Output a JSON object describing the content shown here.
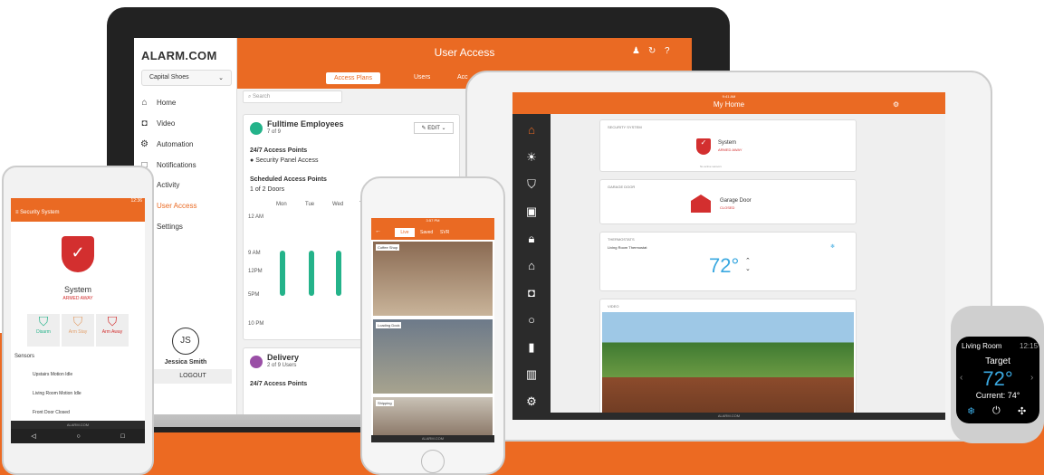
{
  "laptop": {
    "logo": "ALARM.COM",
    "account": "Capital Shoes",
    "title": "User Access",
    "tabs": [
      "Access Plans",
      "Users",
      "Acc"
    ],
    "sidebar": [
      "Home",
      "Video",
      "Automation",
      "Notifications",
      "Activity",
      "User Access",
      "Settings"
    ],
    "search_placeholder": "Search",
    "plan1": {
      "name": "Fulltime Employees",
      "count": "7 of 9",
      "edit": "EDIT",
      "access": "24/7 Access Points",
      "panel": "Security Panel Access",
      "scheduled": "Scheduled Access Points",
      "doors": "1 of 2 Doors",
      "days": [
        "Mon",
        "Tue",
        "Wed",
        "Th"
      ],
      "times": [
        "12 AM",
        "9 AM",
        "12PM",
        "5PM",
        "10 PM"
      ]
    },
    "plan2": {
      "name": "Delivery",
      "count": "2 of 9 Users",
      "access": "24/7 Access Points"
    },
    "user": {
      "initials": "JS",
      "name": "Jessica Smith",
      "logout": "LOGOUT"
    }
  },
  "android": {
    "time": "12:36",
    "title": "Security System",
    "status_label": "System",
    "status": "ARMED AWAY",
    "modes": [
      "Disarm",
      "Arm Stay",
      "Arm Away"
    ],
    "sensors_title": "Sensors",
    "sensors": [
      "Upstairs Motion Idle",
      "Living Room Motion Idle",
      "Front Door Closed"
    ],
    "footer": "ALARM.COM"
  },
  "iphone": {
    "time": "3:57 PM",
    "battery": "100%",
    "tabs": [
      "Live",
      "Saved",
      "SVR"
    ],
    "cams": [
      "Coffee Shop",
      "Loading Dock",
      "Shipping"
    ],
    "footer": "ALARM.COM"
  },
  "ipad": {
    "time": "9:41 AM",
    "battery": "100%",
    "title": "My Home",
    "security_title": "SECURITY SYSTEM",
    "security_label": "System",
    "security_status": "ARMED AWAY",
    "sensors": "No active sensors",
    "garage_title": "GARAGE DOOR",
    "garage_label": "Garage Door",
    "garage_status": "CLOSED",
    "thermo_title": "THERMOSTATS",
    "thermo_name": "Living Room Thermostat",
    "temp": "72°",
    "video_title": "VIDEO",
    "footer": "ALARM.COM"
  },
  "watch": {
    "room": "Living Room",
    "time": "12:15",
    "target_label": "Target",
    "temp": "72°",
    "current": "Current: 74°"
  },
  "colors": {
    "orange": "#ec6a22",
    "red": "#d32f2f",
    "green": "#24b38a"
  }
}
